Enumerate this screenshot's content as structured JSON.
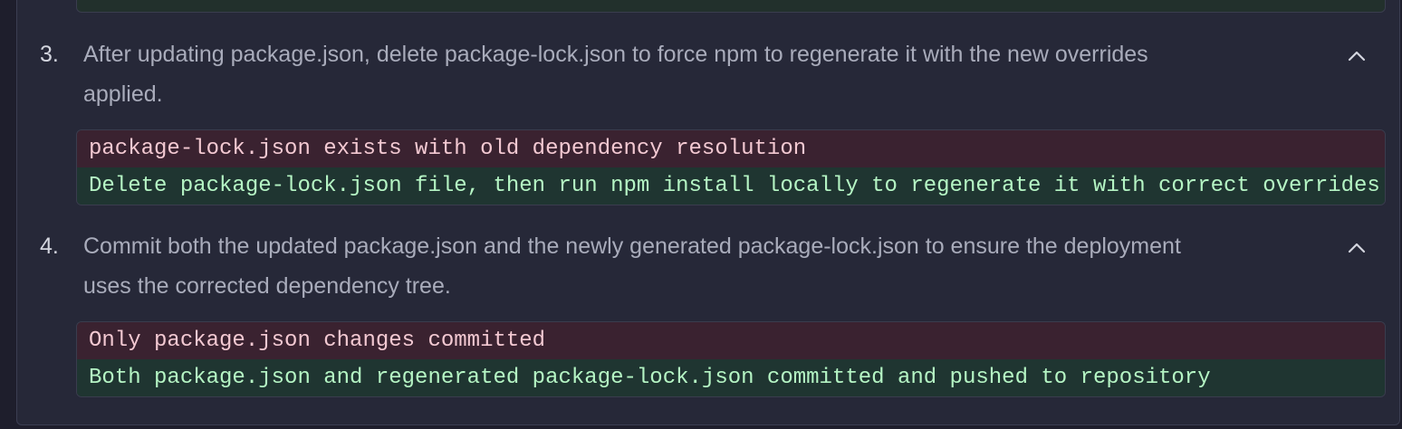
{
  "steps": [
    {
      "number": "3.",
      "text_line1": "After updating package.json, delete package-lock.json to force npm to regenerate it with the new overrides",
      "text_line2": "applied.",
      "old": "package-lock.json exists with old dependency resolution",
      "new": "Delete package-lock.json file, then run npm install locally to regenerate it with correct overrides",
      "toggle_icon": "chevron-up-icon"
    },
    {
      "number": "4.",
      "text_line1": "Commit both the updated package.json and the newly generated package-lock.json to ensure the deployment",
      "text_line2": "uses the corrected dependency tree.",
      "old": "Only package.json changes committed",
      "new": "Both package.json and regenerated package-lock.json committed and pushed to repository",
      "toggle_icon": "chevron-up-icon"
    }
  ],
  "colors": {
    "background": "#1e1e2c",
    "panel": "#262838",
    "diff_removed_bg": "#3a2230",
    "diff_removed_text": "#f3c9d2",
    "diff_added_bg": "#1f3531",
    "diff_added_text": "#b5f5c4"
  }
}
